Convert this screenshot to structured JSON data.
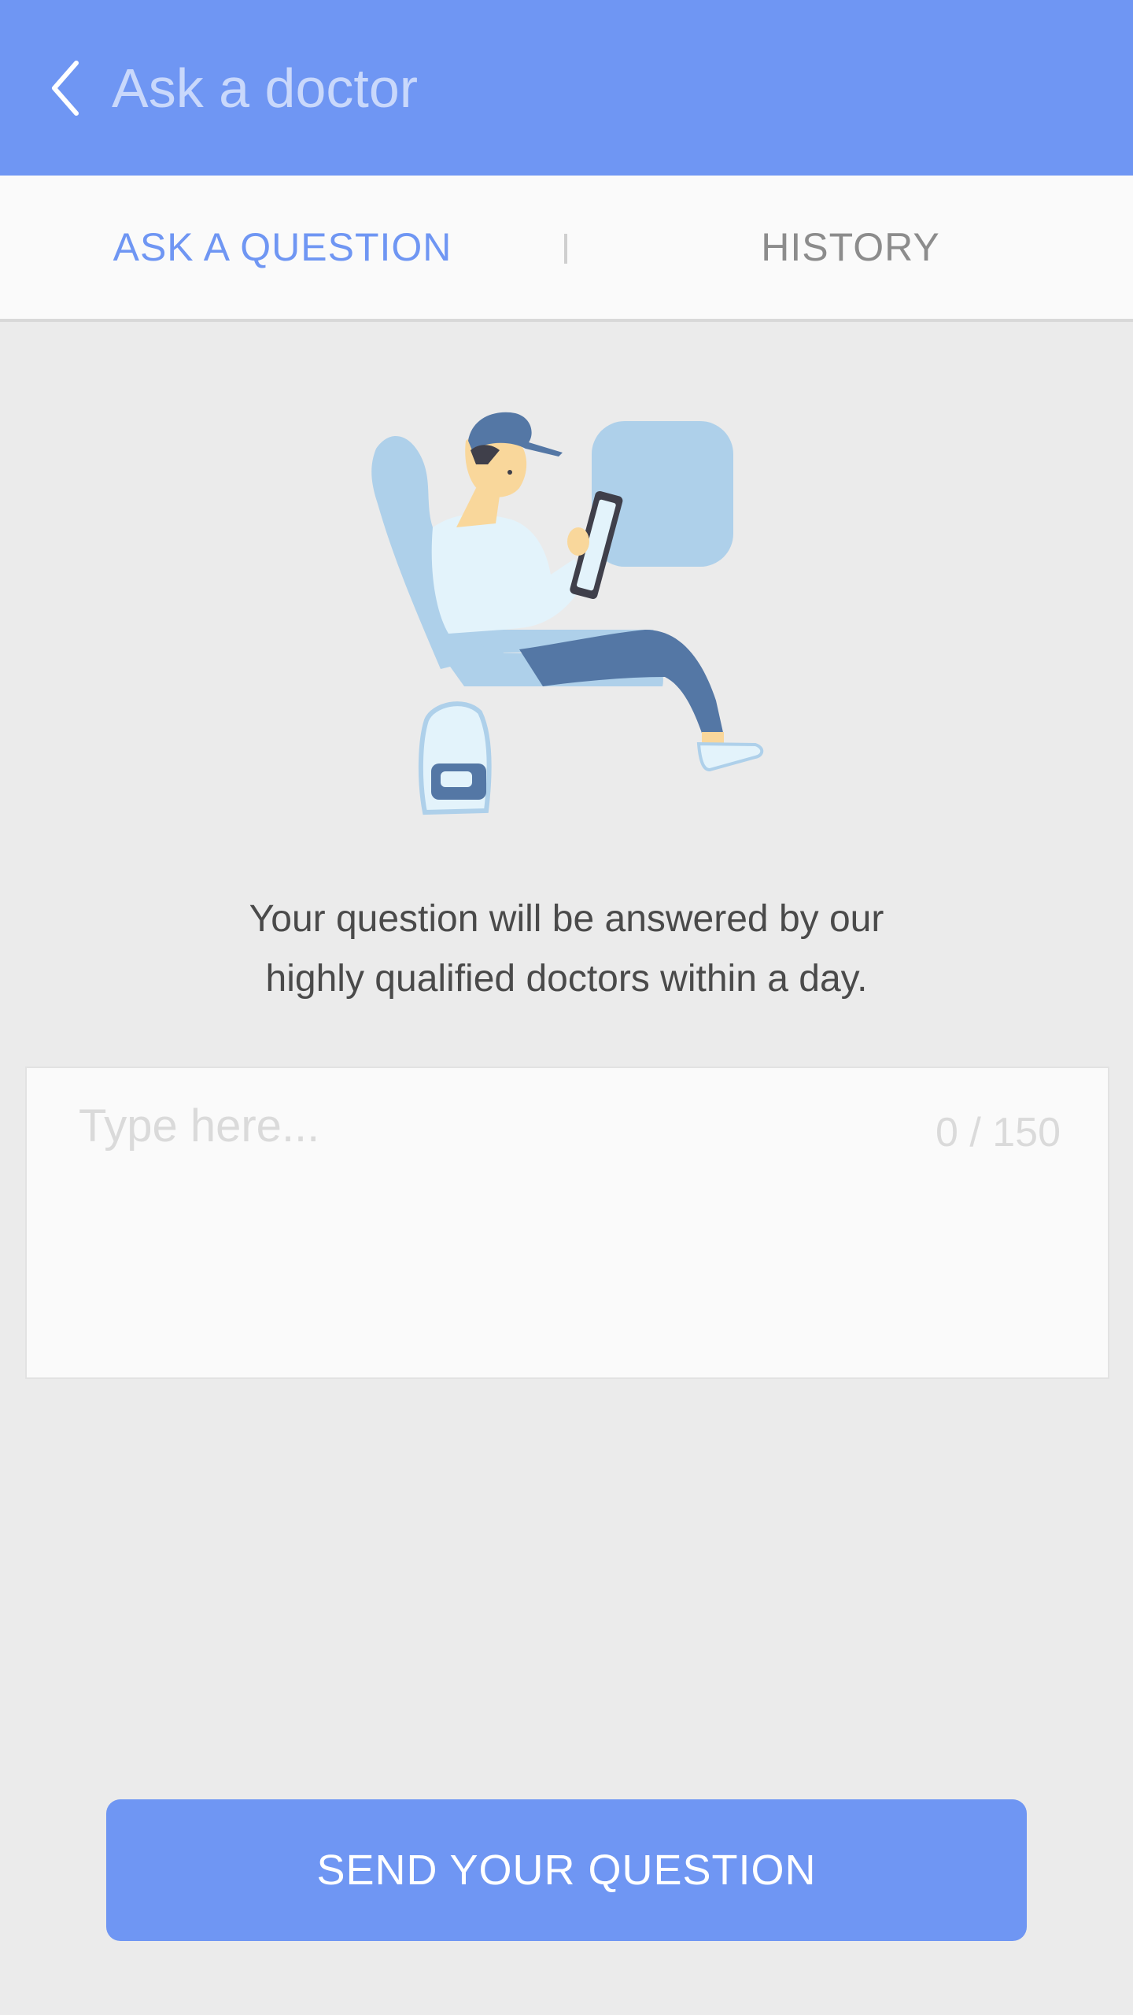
{
  "colors": {
    "primary": "#6f96f3",
    "title_text": "#c9d8fb",
    "background": "#ebebeb",
    "card": "#fafafa",
    "tab_inactive": "#8c8c8c",
    "body_text": "#4a4a4a",
    "placeholder": "#dadada"
  },
  "app_bar": {
    "back_icon": "chevron-left-icon",
    "title": "Ask a doctor"
  },
  "tabs": [
    {
      "label": "ASK A QUESTION",
      "selected": true
    },
    {
      "label": "HISTORY",
      "selected": false
    }
  ],
  "illustration": {
    "icon": "person-reading-tablet-in-seat-illustration"
  },
  "info": {
    "line1": "Your question will be answered by our",
    "line2": "highly qualified doctors within a day."
  },
  "question": {
    "value": "",
    "placeholder": "Type here...",
    "counter": "0 / 150"
  },
  "send_button": {
    "label": "SEND YOUR QUESTION"
  }
}
